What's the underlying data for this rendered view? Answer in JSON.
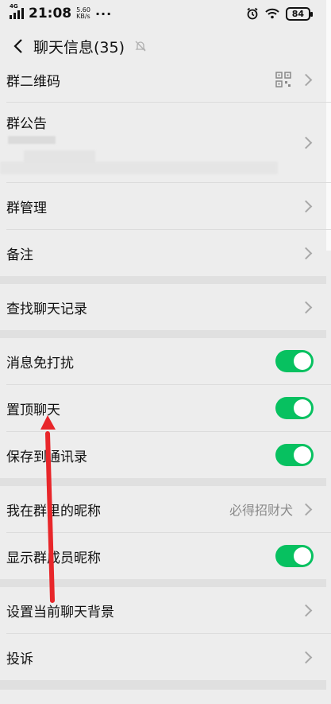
{
  "status": {
    "network": "4G",
    "time": "21:08",
    "speed_value": "5.60",
    "speed_unit": "KB/s",
    "dots": "···",
    "battery": "84"
  },
  "nav": {
    "title": "聊天信息(35)"
  },
  "rows": {
    "qr": "群二维码",
    "notice": "群公告",
    "manage": "群管理",
    "remark": "备注",
    "search": "查找聊天记录",
    "mute": "消息免打扰",
    "pin": "置顶聊天",
    "save": "保存到通讯录",
    "nickname": "我在群里的昵称",
    "nickname_value": "必得招财犬",
    "show_names": "显示群成员昵称",
    "background": "设置当前聊天背景",
    "complain": "投诉"
  },
  "toggles": {
    "mute": true,
    "pin": true,
    "save": true,
    "show_names": true
  },
  "colors": {
    "toggle_on": "#07c160",
    "arrow": "#e8262a"
  }
}
